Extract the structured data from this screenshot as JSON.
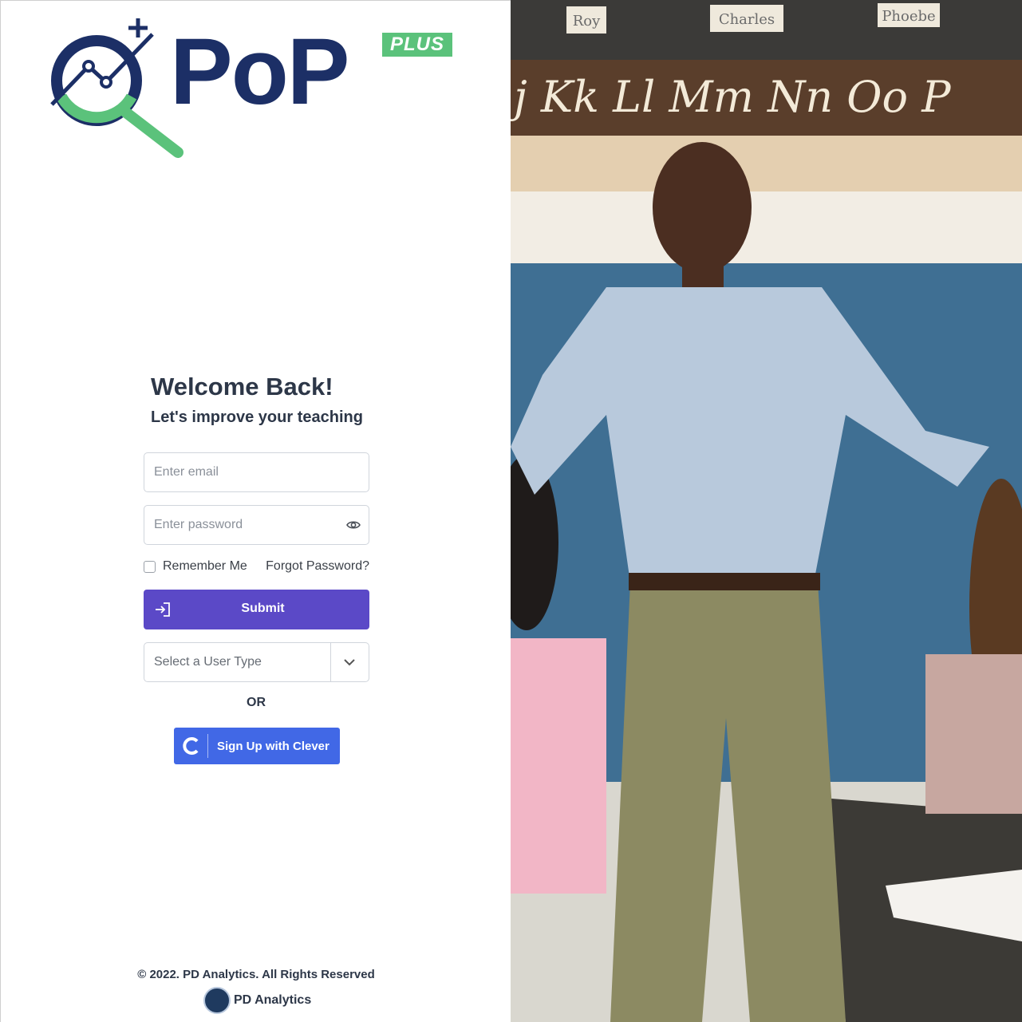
{
  "brand": {
    "name": "PoP",
    "badge": "PLUS"
  },
  "form": {
    "title": "Welcome Back!",
    "subtitle": "Let's improve your teaching",
    "email_placeholder": "Enter email",
    "password_placeholder": "Enter password",
    "remember_label": "Remember Me",
    "forgot_label": "Forgot Password?",
    "submit_label": "Submit",
    "user_type_placeholder": "Select a User Type",
    "or_label": "OR",
    "clever_label": "Sign Up with Clever"
  },
  "photo_board": {
    "name_cards": [
      "Roy",
      "Charles",
      "Phoebe"
    ],
    "cursive_letters": "j Kk Ll Mm Nn Oo P"
  },
  "footer": {
    "copyright": "© 2022. PD Analytics. All Rights Reserved",
    "company": "PD Analytics"
  },
  "colors": {
    "brand_navy": "#1c2f66",
    "brand_green": "#5bc27b",
    "submit_purple": "#5b49c7",
    "clever_blue": "#4168e6"
  }
}
